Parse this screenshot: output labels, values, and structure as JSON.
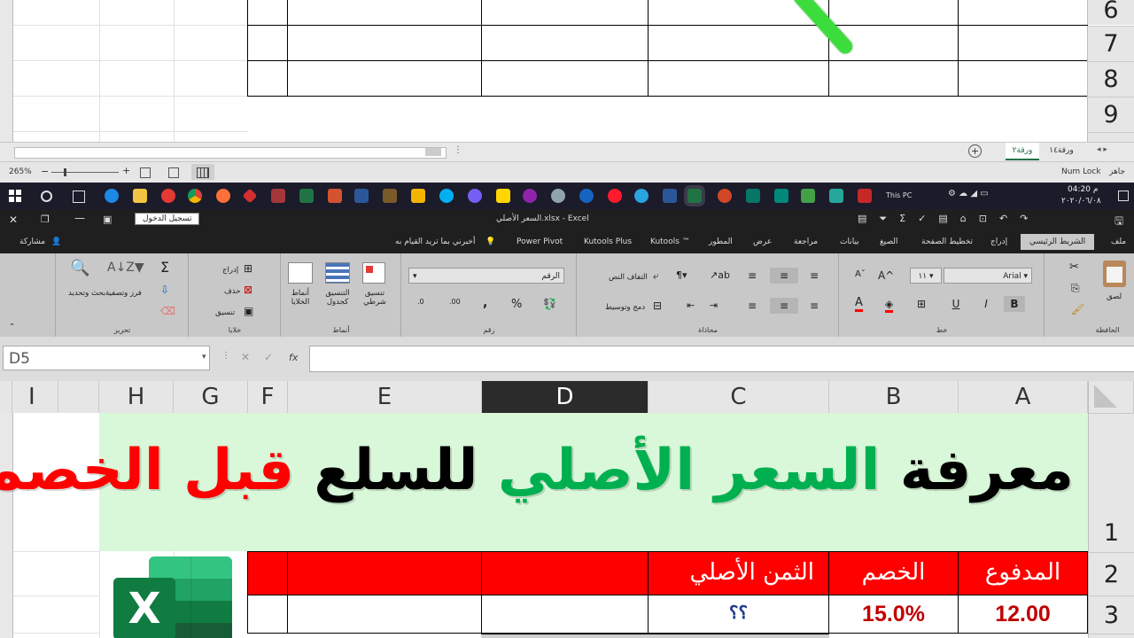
{
  "top_rows": [
    "6",
    "7",
    "8",
    "9"
  ],
  "sheet_tabs": [
    "ورقة٢",
    "ورقة١٤"
  ],
  "status": {
    "ready": "جاهز",
    "numlock": "Num Lock",
    "zoom": "265%"
  },
  "taskbar": {
    "time": "04:20 م",
    "date": "٢٠٢٠/٠٦/٠٨",
    "pc": "This PC"
  },
  "titlebar": {
    "title": "السعر الأصلي.xlsx  -  Excel",
    "signin": "تسجيل الدخول"
  },
  "ribbon_tabs": [
    "ملف",
    "الشريط الرئيسي",
    "إدراج",
    "تخطيط الصفحة",
    "الصيغ",
    "بيانات",
    "مراجعة",
    "عرض",
    "المطور",
    "Kutools ™",
    "Kutools Plus",
    "Power Pivot",
    "أخبرني بما تريد القيام به",
    "مشاركة"
  ],
  "ribbon": {
    "clipboard": {
      "label": "الحافظة",
      "paste": "لصق"
    },
    "font": {
      "label": "خط",
      "name": "Arial",
      "size": "١١",
      "bold": "B",
      "italic": "I",
      "underline": "U"
    },
    "alignment": {
      "label": "محاذاة",
      "wrap": "التفاف النص",
      "merge": "دمج وتوسيط"
    },
    "number": {
      "label": "رقم",
      "format": "الرقم",
      "percent": "%",
      "comma": ","
    },
    "styles": {
      "label": "أنماط",
      "conditional": "تنسيق شرطي",
      "table": "التنسيق كجدول",
      "cell": "أنماط الخلايا"
    },
    "cells": {
      "label": "خلايا",
      "insert": "إدراج",
      "delete": "حذف",
      "format": "تنسيق"
    },
    "editing": {
      "label": "تحرير",
      "sort": "فرز وتصفية",
      "find": "بحث وتحديد",
      "sigma": "Σ"
    }
  },
  "formula_bar": {
    "name_box": "D5",
    "fx": "fx",
    "value": ""
  },
  "columns": [
    "A",
    "B",
    "C",
    "D",
    "E",
    "F",
    "G",
    "H",
    "I"
  ],
  "sheet": {
    "rows": [
      "1",
      "2",
      "3"
    ],
    "title_parts": [
      {
        "text": "معرفة",
        "color": "#000000"
      },
      {
        "text": "السعر الأصلي",
        "color": "#00b050"
      },
      {
        "text": "للسلع",
        "color": "#000000"
      },
      {
        "text": "قبل الخصم",
        "color": "#ff0000"
      }
    ],
    "headers": {
      "paid": "المدفوع",
      "discount": "الخصم",
      "original": "الثمن الأصلي"
    },
    "values": {
      "paid": "12.00",
      "discount": "15.0%",
      "original": "؟؟"
    }
  },
  "colors": {
    "title_bg": "#d9f7d9",
    "header_red": "#ff0000",
    "value_red": "#c00000",
    "excel_green": "#1d6f42"
  }
}
